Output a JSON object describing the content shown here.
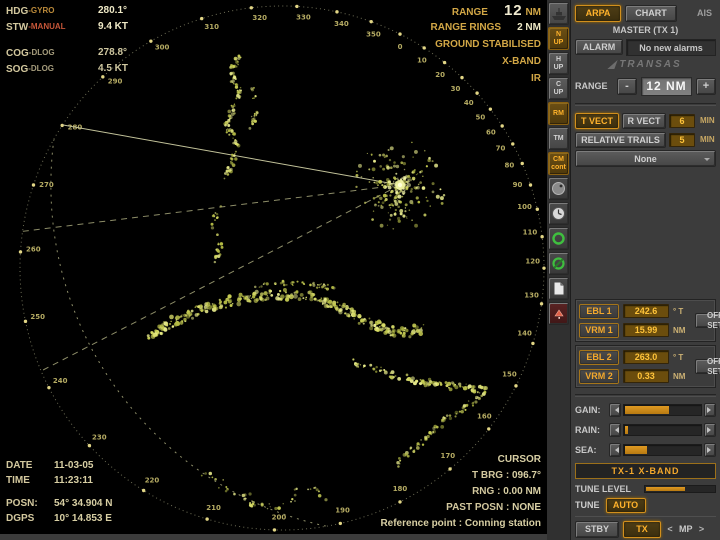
{
  "radar": {
    "top_left": {
      "rows": [
        {
          "label": "HDG",
          "suffix": "-GYRO",
          "value": "280.1°"
        },
        {
          "label": "STW",
          "suffix": "-MANUAL",
          "value": "9.4 KT"
        },
        {
          "label": "COG",
          "suffix": "-DLOG",
          "value": "278.8°"
        },
        {
          "label": "SOG",
          "suffix": "-DLOG",
          "value": "4.5 KT"
        }
      ]
    },
    "top_right": {
      "range_label": "RANGE",
      "range_value": "12",
      "range_unit": "NM",
      "rings_label": "RANGE RINGS",
      "rings_value": "2 NM",
      "stabilisation": "GROUND STABILISED",
      "band": "X-BAND",
      "interference": "IR"
    },
    "bottom_left": {
      "date_label": "DATE",
      "date_value": "11-03-05",
      "time_label": "TIME",
      "time_value": "11:23:11",
      "posn_label": "POSN:",
      "posn_value": "54° 34.904 N",
      "dgps_label": "DGPS",
      "dgps_value": "10° 14.853 E"
    },
    "bottom_right": {
      "cursor_title": "CURSOR",
      "tbrg_label": "T BRG :",
      "tbrg_value": "096.7°",
      "rng_label": "RNG :",
      "rng_value": "0.00 NM",
      "past_label": "PAST POSN :",
      "past_value": "NONE",
      "reference": "Reference point : Conning station"
    },
    "readouts": {
      "heading_deg": 280.1,
      "ebl1_deg": 242.6,
      "ebl2_deg": 263.0,
      "vrm1_nm": 15.99,
      "vrm2_nm": 0.33,
      "range_nm": 12
    }
  },
  "strip": {
    "items": [
      {
        "name": "ship"
      },
      {
        "name": "north-up",
        "line1": "N",
        "line2": "UP",
        "active": true
      },
      {
        "name": "head-up",
        "line1": "H",
        "line2": "UP"
      },
      {
        "name": "course-up",
        "line1": "C",
        "line2": "UP"
      },
      {
        "name": "relative-motion",
        "line1": "RM",
        "active": true
      },
      {
        "name": "true-motion",
        "line1": "TM"
      },
      {
        "name": "cm-cont",
        "line1": "CM",
        "line2": "cont",
        "active": true
      }
    ]
  },
  "panel": {
    "tabs": {
      "arpa": "ARPA",
      "chart": "CHART",
      "ais": "AIS"
    },
    "master": "MASTER (TX 1)",
    "alarm_label": "ALARM",
    "alarm_value": "No new alarms",
    "brand": "TRANSAS",
    "range": {
      "label": "RANGE",
      "minus": "-",
      "value": "12 NM",
      "plus": "+"
    },
    "vectors": {
      "t": "T VECT",
      "r": "R VECT",
      "value": "6",
      "unit": "MIN"
    },
    "trails": {
      "label": "RELATIVE TRAILS",
      "value": "5",
      "unit": "MIN",
      "mode": "None"
    },
    "ebl1": {
      "ebl": "EBL 1",
      "vrm": "VRM 1",
      "brg": "242.6",
      "brg_unit": "° T",
      "rng": "15.99",
      "rng_unit": "NM",
      "off": "OFF",
      "set": "SET"
    },
    "ebl2": {
      "ebl": "EBL 2",
      "vrm": "VRM 2",
      "brg": "263.0",
      "brg_unit": "° T",
      "rng": "0.33",
      "rng_unit": "NM",
      "off": "OFF",
      "set": "SET"
    },
    "sliders": [
      {
        "label": "GAIN:",
        "value": 57
      },
      {
        "label": "RAIN:",
        "value": 4
      },
      {
        "label": "SEA:",
        "value": 28
      }
    ],
    "tx_bar": "TX-1  X-BAND",
    "tune": {
      "level_label": "TUNE LEVEL",
      "level": 55,
      "label": "TUNE",
      "auto": "AUTO"
    },
    "bottom": {
      "stby": "STBY",
      "tx": "TX",
      "prev": "<",
      "mp": "MP",
      "next": ">"
    }
  },
  "colors": {
    "accent": "#ffb22b",
    "echo": "#ccd155",
    "panel": "#3c3c3c",
    "amber_box": "#6b4d0d"
  }
}
